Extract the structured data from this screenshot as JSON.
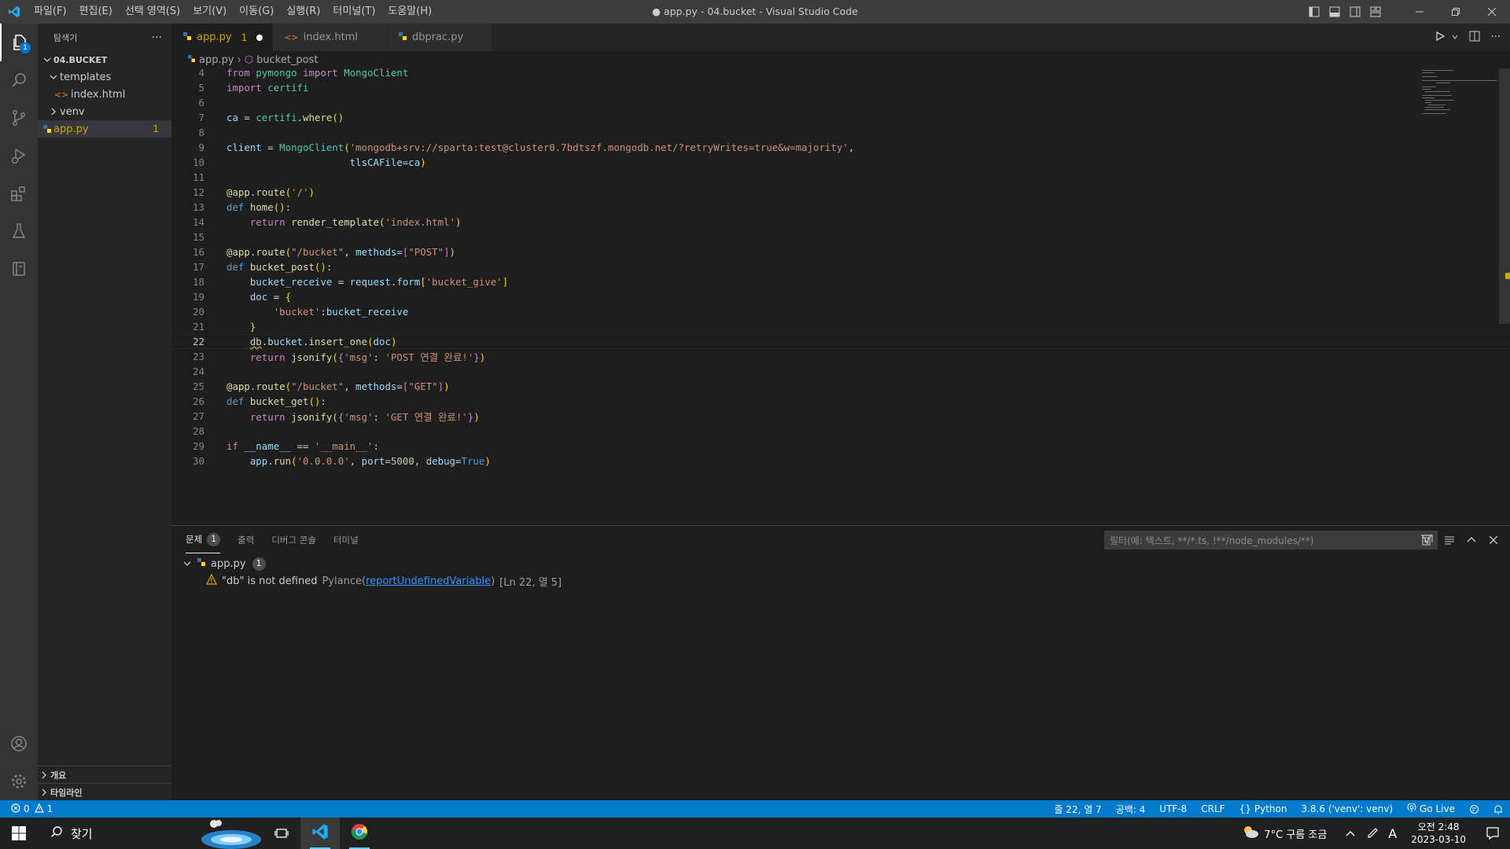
{
  "window": {
    "title": "● app.py - 04.bucket - Visual Studio Code",
    "menu": [
      "파일(F)",
      "편집(E)",
      "선택 영역(S)",
      "보기(V)",
      "이동(G)",
      "실행(R)",
      "터미널(T)",
      "도움말(H)"
    ]
  },
  "activity": {
    "explorer_badge": "1",
    "icons": [
      "files-icon",
      "search-icon",
      "source-control-icon",
      "run-debug-icon",
      "extensions-icon",
      "testing-icon",
      "database-icon"
    ]
  },
  "sidebar": {
    "title": "탐색기",
    "more": "···",
    "root": "04.BUCKET",
    "items": [
      {
        "label": "templates"
      },
      {
        "label": "index.html"
      },
      {
        "label": "venv"
      },
      {
        "label": "app.py",
        "count": "1"
      }
    ],
    "sections": [
      "개요",
      "타임라인"
    ]
  },
  "tabs": [
    {
      "label": "app.py",
      "count": "1"
    },
    {
      "label": "index.html"
    },
    {
      "label": "dbprac.py"
    }
  ],
  "breadcrumb": {
    "file": "app.py",
    "symbol": "bucket_post"
  },
  "code": {
    "line_numbers": [
      "4",
      "5",
      "6",
      "7",
      "8",
      "9",
      "10",
      "11",
      "12",
      "13",
      "14",
      "15",
      "16",
      "17",
      "18",
      "19",
      "20",
      "21",
      "22",
      "23",
      "24",
      "25",
      "26",
      "27",
      "28",
      "29",
      "30"
    ],
    "current_line": "22"
  },
  "panel": {
    "tabs": [
      {
        "label": "문제",
        "badge": "1"
      },
      {
        "label": "출력"
      },
      {
        "label": "디버그 콘솔"
      },
      {
        "label": "터미널"
      }
    ],
    "filter_placeholder": "필터(예: 텍스트, **/*.ts, !**/node_modules/**)",
    "file": "app.py",
    "file_count": "1",
    "problem": {
      "message": "\"db\" is not defined",
      "source": "Pylance",
      "code": "reportUndefinedVariable",
      "location": "[Ln 22, 열 5]"
    }
  },
  "status": {
    "errors": "0",
    "warnings": "1",
    "position": "줄 22, 열 7",
    "spaces": "공백: 4",
    "encoding": "UTF-8",
    "eol": "CRLF",
    "language": "Python",
    "interpreter": "3.8.6 ('venv': venv)",
    "golive": "Go Live"
  },
  "taskbar": {
    "search": "찾기",
    "weather": "7°C 구름 조금",
    "ime": "A",
    "time": "오전 2:48",
    "date": "2023-03-10"
  },
  "colors": {
    "statusbar": "#007acc",
    "warning": "#cca700",
    "titlebar": "#3c3c3c"
  }
}
